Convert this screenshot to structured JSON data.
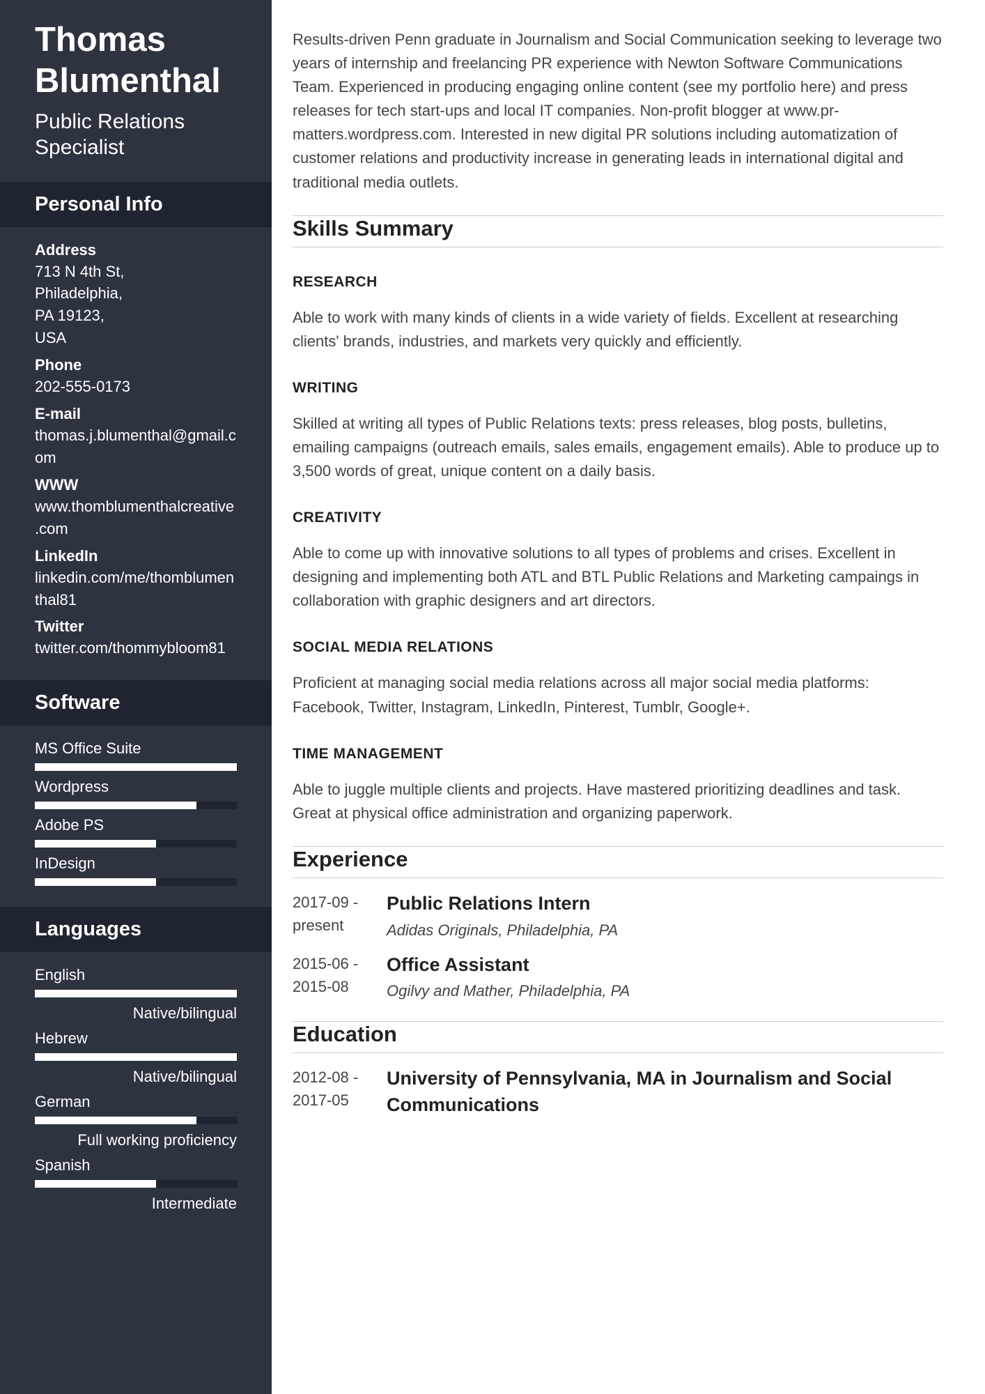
{
  "header": {
    "name": "Thomas Blumenthal",
    "title": "Public Relations Specialist"
  },
  "sidebar": {
    "personal_info_header": "Personal Info",
    "info": [
      {
        "label": "Address",
        "value": "713 N 4th St,\nPhiladelphia,\nPA 19123,\nUSA"
      },
      {
        "label": "Phone",
        "value": "202-555-0173"
      },
      {
        "label": "E-mail",
        "value": "thomas.j.blumenthal@gmail.com"
      },
      {
        "label": "WWW",
        "value": "www.thomblumenthalcreative.com"
      },
      {
        "label": "LinkedIn",
        "value": "linkedin.com/me/thomblumenthal81"
      },
      {
        "label": "Twitter",
        "value": "twitter.com/thommybloom81"
      }
    ],
    "software_header": "Software",
    "software": [
      {
        "name": "MS Office Suite",
        "pct": 100
      },
      {
        "name": "Wordpress",
        "pct": 80
      },
      {
        "name": "Adobe PS",
        "pct": 60
      },
      {
        "name": "InDesign",
        "pct": 60
      }
    ],
    "languages_header": "Languages",
    "languages": [
      {
        "name": "English",
        "pct": 100,
        "level": "Native/bilingual"
      },
      {
        "name": "Hebrew",
        "pct": 100,
        "level": "Native/bilingual"
      },
      {
        "name": "German",
        "pct": 80,
        "level": "Full working proficiency"
      },
      {
        "name": "Spanish",
        "pct": 60,
        "level": "Intermediate"
      }
    ]
  },
  "main": {
    "summary": "Results-driven Penn graduate in Journalism and Social Communication seeking to leverage two years of internship and freelancing PR experience with Newton Software Communications Team. Experienced in producing engaging online content (see my portfolio here) and press releases for tech start-ups and local IT companies. Non-profit blogger at www.pr-matters.wordpress.com. Interested in new digital PR solutions including automatization of customer relations and productivity increase in generating leads in international digital and traditional media outlets.",
    "skills_header": "Skills Summary",
    "skills": [
      {
        "heading": "RESEARCH",
        "desc": "Able to work with many kinds of clients in a wide variety of fields. Excellent at researching clients' brands, industries, and markets very quickly and efficiently."
      },
      {
        "heading": "WRITING",
        "desc": "Skilled at writing all types of Public Relations texts: press releases, blog posts, bulletins, emailing campaigns (outreach emails, sales emails, engagement emails). Able to produce up to 3,500 words of great, unique content on a daily basis."
      },
      {
        "heading": "CREATIVITY",
        "desc": "Able to come up with innovative solutions to all types of problems and crises. Excellent in designing and implementing both ATL and BTL Public Relations and Marketing campaings in collaboration with graphic designers and art directors."
      },
      {
        "heading": "SOCIAL MEDIA RELATIONS",
        "desc": "Proficient at managing social media relations across all major social media platforms: Facebook, Twitter, Instagram, LinkedIn, Pinterest, Tumblr, Google+."
      },
      {
        "heading": "TIME MANAGEMENT",
        "desc": "Able to juggle multiple clients and projects. Have mastered prioritizing deadlines and task. Great at physical office administration and organizing paperwork."
      }
    ],
    "experience_header": "Experience",
    "experience": [
      {
        "dates": "2017-09 - present",
        "title": "Public Relations Intern",
        "company": "Adidas Originals, Philadelphia, PA"
      },
      {
        "dates": "2015-06 - 2015-08",
        "title": "Office Assistant",
        "company": "Ogilvy and Mather, Philadelphia, PA"
      }
    ],
    "education_header": "Education",
    "education": [
      {
        "dates": "2012-08 - 2017-05",
        "title": "University of Pennsylvania, MA in Journalism and Social Communications"
      }
    ]
  }
}
